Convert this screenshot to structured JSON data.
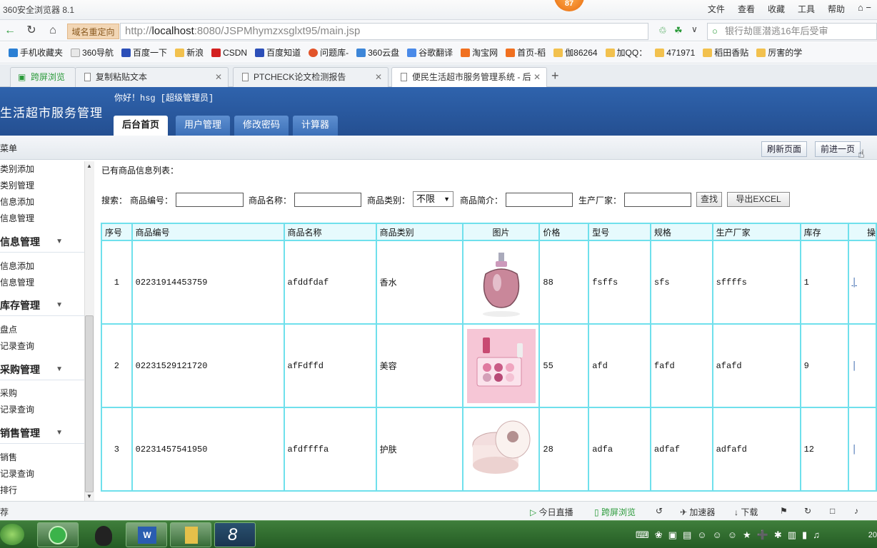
{
  "browser": {
    "title": "360安全浏览器 8.1",
    "menu": [
      "文件",
      "查看",
      "收藏",
      "工具",
      "帮助"
    ],
    "notify_badge": "87",
    "domain_redirect": "域名重定向",
    "url_prefix": "http://",
    "url_host": "localhost",
    "url_rest": ":8080/JSPMhymzxsglxt95/main.jsp",
    "search_text": "银行劫匪潜逃16年后受审",
    "bookmarks": [
      "手机收藏夹",
      "360导航",
      "百度一下",
      "新浪",
      "CSDN",
      "百度知道",
      "问题库-",
      "360云盘",
      "谷歌翻译",
      "淘宝网",
      "首页-稻",
      "伽86264",
      "加QQ：",
      "471971",
      "稻田香贴",
      "厉害的学"
    ],
    "tabs": [
      {
        "label": "跨屏浏览"
      },
      {
        "label": "复制粘贴文本"
      },
      {
        "label": "PTCHECK论文检测报告"
      },
      {
        "label": "便民生活超市服务管理系统 - 后"
      }
    ],
    "new_tab": "+"
  },
  "app": {
    "title": "生活超市服务管理",
    "greeting": "你好！hsg [超级管理员]",
    "nav_tabs": [
      "后台首页",
      "用户管理",
      "修改密码",
      "计算器"
    ],
    "menu_title": "菜单",
    "refresh_btn": "刷新页面",
    "forward_btn": "前进一页"
  },
  "sidebar": {
    "items_a": [
      "类别添加",
      "类别管理",
      "信息添加",
      "信息管理"
    ],
    "section1": "信息管理",
    "items_b": [
      "信息添加",
      "信息管理"
    ],
    "section2": "库存管理",
    "items_c": [
      "盘点",
      "记录查询"
    ],
    "section3": "采购管理",
    "items_d": [
      "采购",
      "记录查询"
    ],
    "section4": "销售管理",
    "items_e": [
      "销售",
      "记录查询",
      "排行"
    ]
  },
  "main": {
    "list_label": "已有商品信息列表：",
    "search": {
      "label": "搜索：",
      "code_label": "商品编号：",
      "name_label": "商品名称：",
      "category_label": "商品类别：",
      "category_value": "不限",
      "intro_label": "商品简介：",
      "maker_label": "生产厂家：",
      "find_btn": "查找",
      "export_btn": "导出EXCEL"
    },
    "columns": [
      "序号",
      "商品编号",
      "商品名称",
      "商品类别",
      "图片",
      "价格",
      "型号",
      "规格",
      "生产厂家",
      "库存",
      "操"
    ],
    "rows": [
      {
        "no": "1",
        "code": "02231914453759",
        "name": "afddfdaf",
        "category": "香水",
        "image": "perfume-bottle",
        "price": "88",
        "model": "fsffs",
        "spec": "sfs",
        "maker": "sffffs",
        "stock": "1"
      },
      {
        "no": "2",
        "code": "02231529121720",
        "name": "afFdffd",
        "category": "美容",
        "image": "makeup-palette",
        "price": "55",
        "model": "afd",
        "spec": "fafd",
        "maker": "afafd",
        "stock": "9"
      },
      {
        "no": "3",
        "code": "02231457541950",
        "name": "afdffffa",
        "category": "护肤",
        "image": "cream-jar",
        "price": "28",
        "model": "adfa",
        "spec": "adfaf",
        "maker": "adfafd",
        "stock": "12"
      }
    ]
  },
  "statusbar": {
    "left": "荐",
    "items": [
      "今日直播",
      "跨屏浏览",
      "加速器",
      "下载"
    ]
  },
  "taskbar": {
    "clock": "20"
  }
}
